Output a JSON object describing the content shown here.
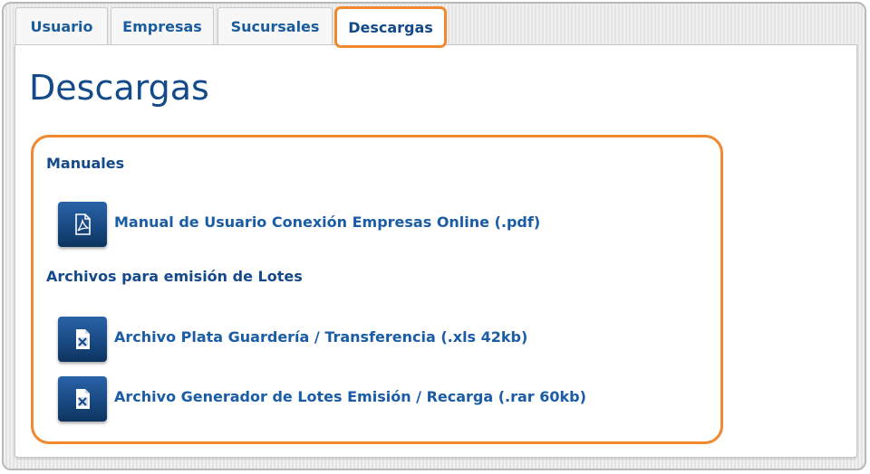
{
  "tabs": [
    {
      "label": "Usuario"
    },
    {
      "label": "Empresas"
    },
    {
      "label": "Sucursales"
    },
    {
      "label": "Descargas",
      "active": true
    }
  ],
  "page": {
    "title": "Descargas"
  },
  "sections": [
    {
      "heading": "Manuales",
      "items": [
        {
          "label": "Manual de Usuario Conexión Empresas Online (.pdf)",
          "icon": "pdf-icon"
        }
      ]
    },
    {
      "heading": "Archivos para emisión de Lotes",
      "items": [
        {
          "label": "Archivo Plata Guardería / Transferencia (.xls 42kb)",
          "icon": "excel-icon"
        },
        {
          "label": "Archivo Generador de Lotes Emisión / Recarga (.rar 60kb)",
          "icon": "excel-icon"
        }
      ]
    }
  ],
  "colors": {
    "accent": "#f0892d",
    "title": "#154a8a",
    "link": "#1a5ca5"
  }
}
